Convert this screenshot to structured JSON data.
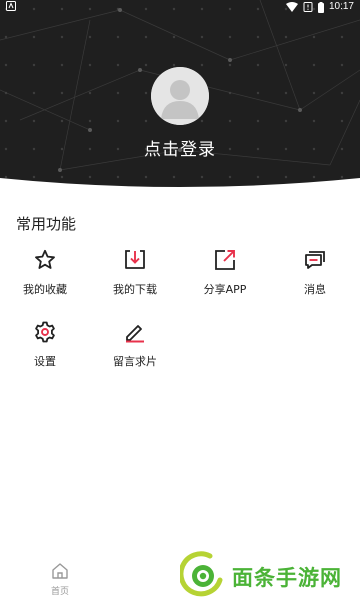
{
  "status_bar": {
    "time": "10:17"
  },
  "header": {
    "login_text": "点击登录"
  },
  "functions": {
    "title": "常用功能",
    "items": [
      {
        "label": "我的收藏",
        "icon": "star-icon"
      },
      {
        "label": "我的下载",
        "icon": "download-icon"
      },
      {
        "label": "分享APP",
        "icon": "share-icon"
      },
      {
        "label": "消息",
        "icon": "message-icon"
      },
      {
        "label": "设置",
        "icon": "gear-icon"
      },
      {
        "label": "留言求片",
        "icon": "pencil-icon"
      }
    ]
  },
  "bottom_nav": {
    "home_label": "首页"
  },
  "watermark": {
    "text": "面条手游网"
  },
  "colors": {
    "header_bg": "#1f1f1f",
    "accent_red": "#e8314b",
    "watermark_green": "#4bb337"
  }
}
